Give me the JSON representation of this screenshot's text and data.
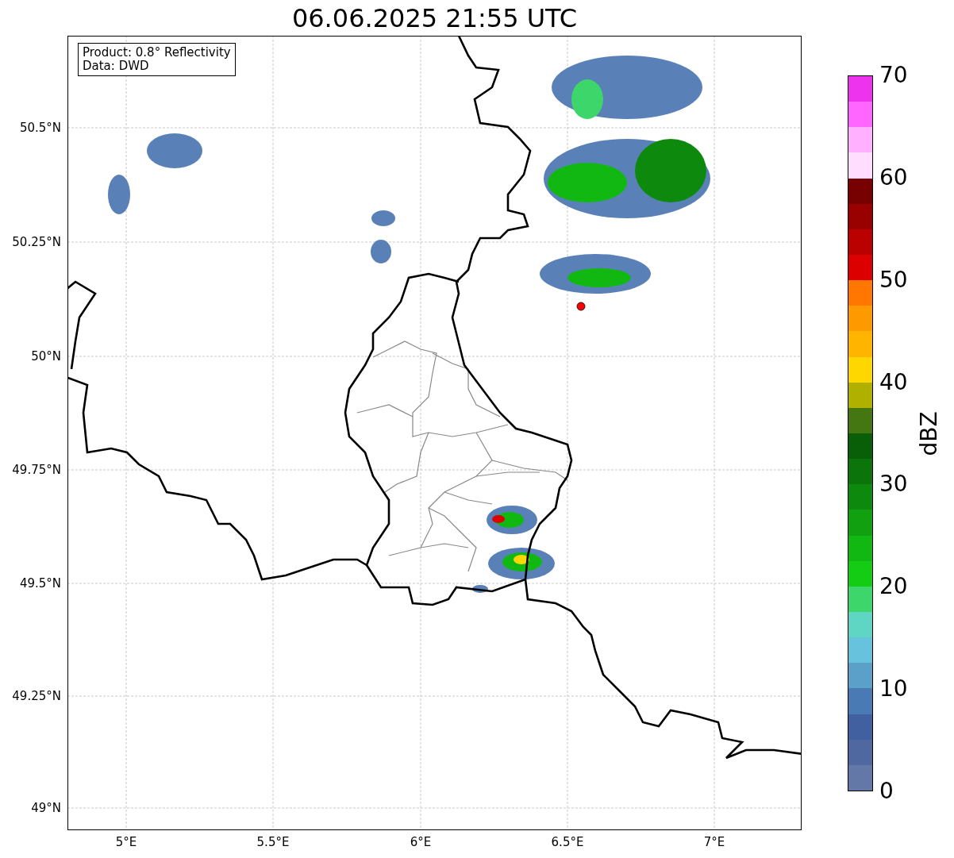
{
  "title": "06.06.2025 21:55 UTC",
  "info_box": {
    "lines": [
      "Product: 0.8° Reflectivity",
      "Data: DWD"
    ]
  },
  "y_axis": {
    "ticks": [
      "50.5°N",
      "50.25°N",
      "50°N",
      "49.75°N",
      "49.5°N",
      "49.25°N",
      "49°N"
    ]
  },
  "x_axis": {
    "ticks": [
      "5°E",
      "5.5°E",
      "6°E",
      "6.5°E",
      "7°E"
    ]
  },
  "colorbar": {
    "label": "dBZ",
    "ticks": [
      "70",
      "60",
      "50",
      "40",
      "30",
      "20",
      "10",
      "0"
    ],
    "segments": [
      {
        "color": "#6478a8"
      },
      {
        "color": "#5068a0"
      },
      {
        "color": "#4060a0"
      },
      {
        "color": "#4a7ab3"
      },
      {
        "color": "#5ba0c8"
      },
      {
        "color": "#66c2dd"
      },
      {
        "color": "#5fd6c4"
      },
      {
        "color": "#3dd66b"
      },
      {
        "color": "#14cc14"
      },
      {
        "color": "#12b812"
      },
      {
        "color": "#10a010"
      },
      {
        "color": "#0d8a0d"
      },
      {
        "color": "#0b750b"
      },
      {
        "color": "#085f08"
      },
      {
        "color": "#447711"
      },
      {
        "color": "#b0b000"
      },
      {
        "color": "#ffd700"
      },
      {
        "color": "#ffb400"
      },
      {
        "color": "#ff9900"
      },
      {
        "color": "#ff7700"
      },
      {
        "color": "#dd0000"
      },
      {
        "color": "#bb0000"
      },
      {
        "color": "#990000"
      },
      {
        "color": "#770000"
      },
      {
        "color": "#ffddff"
      },
      {
        "color": "#ffb0ff"
      },
      {
        "color": "#ff66ff"
      },
      {
        "color": "#ee33ee"
      }
    ]
  }
}
